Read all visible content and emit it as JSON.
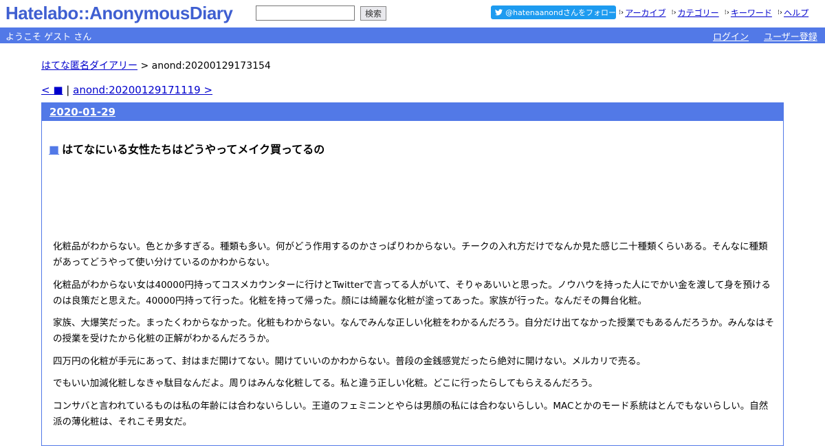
{
  "header": {
    "logo": "Hatelabo::AnonymousDiary",
    "search_button": "検索",
    "twitter_follow": "@hatenaanondさんをフォロー",
    "links": [
      "アーカイブ",
      "カテゴリー",
      "キーワード",
      "ヘルプ"
    ]
  },
  "bar": {
    "welcome": "ようこそ ゲスト さん",
    "login": "ログイン",
    "register": "ユーザー登録"
  },
  "breadcrumb": {
    "home": "はてな匿名ダイアリー",
    "separator": ">",
    "current": "anond:20200129173154"
  },
  "pager": {
    "prev": "< ■",
    "separator": "|",
    "next": "anond:20200129171119 >"
  },
  "day": {
    "date": "2020-01-29",
    "title_marker": "■",
    "title": "はてなにいる女性たちはどうやってメイク買ってるの",
    "paragraphs": [
      "化粧品がわからない。色とか多すぎる。種類も多い。何がどう作用するのかさっぱりわからない。チークの入れ方だけでなんか見た感じ二十種類くらいある。そんなに種類があってどうやって使い分けているのかわからない。",
      "化粧品がわからない女は40000円持ってコスメカウンターに行けとTwitterで言ってる人がいて、そりゃあいいと思った。ノウハウを持った人にでかい金を渡して身を預けるのは良策だと思えた。40000円持って行った。化粧を持って帰った。顔には綺麗な化粧が塗ってあった。家族が行った。なんだその舞台化粧。",
      "家族、大爆笑だった。まったくわからなかった。化粧もわからない。なんでみんな正しい化粧をわかるんだろう。自分だけ出てなかった授業でもあるんだろうか。みんなはその授業を受けたから化粧の正解がわかるんだろうか。",
      "四万円の化粧が手元にあって、封はまだ開けてない。開けていいのかわからない。普段の金銭感覚だったら絶対に開けない。メルカリで売る。",
      "でもいい加減化粧しなきゃ駄目なんだよ。周りはみんな化粧してる。私と違う正しい化粧。どこに行ったらしてもらえるんだろう。",
      "コンサバと言われているものは私の年齢には合わないらしい。王道のフェミニンとやらは男顔の私には合わないらしい。MACとかのモード系統はとんでもないらしい。自然派の薄化粧は、それこそ男女だ。"
    ]
  },
  "colors": {
    "accent": "#5279e7",
    "logo": "#3f5fd1",
    "twitter": "#1d9bf0",
    "link": "#0000cc"
  },
  "icons": [
    "twitter-bird-icon",
    "arrow-right-icon"
  ]
}
